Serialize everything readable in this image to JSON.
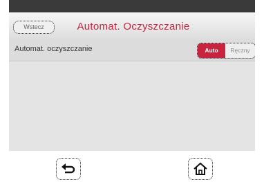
{
  "header": {
    "back_label": "Wstecz",
    "title": "Automat. Oczyszczanie"
  },
  "setting": {
    "label": "Automat. oczyszczanie",
    "options": [
      "Auto",
      "Ręczny"
    ],
    "selected": "Auto"
  },
  "hardware_buttons": {
    "back_icon": "back-arrow-icon",
    "home_icon": "home-icon"
  },
  "colors": {
    "accent": "#c8243f"
  }
}
